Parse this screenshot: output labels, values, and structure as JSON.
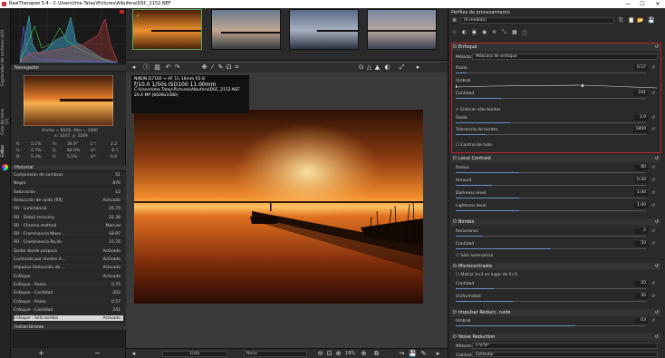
{
  "titlebar": {
    "title": "RawTherapee 5.4 - C:\\Users\\Ima Tatay\\Pictures\\Albufera\\DSC_2152.NEF",
    "minimize": "—",
    "maximize": "☐",
    "close": "✕"
  },
  "left_tabs": {
    "filebrowser": "Explorador de archivos (43)",
    "queue": "Cola de lotes [2]",
    "editor": "Editor"
  },
  "navigator": {
    "header": "Navegador",
    "size": "Ancho = 6028, Alto = 3380",
    "coords": "x: 3347, y: 3149"
  },
  "readout": {
    "r": "R:",
    "r_v": "5.1%",
    "g": "G:",
    "g_v": "4.7%",
    "b": "B:",
    "b_v": "5.3%",
    "h": "H:",
    "h_v": "34.9°",
    "s": "S:",
    "s_v": "84.0%",
    "vv": "V:",
    "vv_v": "5.1%",
    "L": "L*:",
    "L_v": "2.2",
    "a": "a*:",
    "a_v": "-0.7",
    "bb": "b*:",
    "bb_v": "4.0"
  },
  "history": {
    "header": "Historial",
    "rows": [
      [
        "Compresión de sombras",
        "51"
      ],
      [
        "Negro",
        "876"
      ],
      [
        "Saturación",
        "12"
      ],
      [
        "Reducción de ruido (RR)",
        "Activado"
      ],
      [
        "RR - Luminancia",
        "26.70"
      ],
      [
        "RR - Detail recovery",
        "22.38"
      ],
      [
        "RR - Chroma method",
        "Manual"
      ],
      [
        "RR - Crominancia Maes...",
        "18.97"
      ],
      [
        "RR - Crominancia Ro,Ve",
        "15.76"
      ],
      [
        "Quitar borde púrpura",
        "Activado"
      ],
      [
        "Contraste por niveles d...",
        "Activado"
      ],
      [
        "Impulsar Reducción de ...",
        "Activado"
      ],
      [
        "Enfoque",
        "Activado"
      ],
      [
        "Enfoque - Radio",
        "0.75"
      ],
      [
        "Enfoque - Cantidad",
        "202"
      ],
      [
        "Enfoque - Radio",
        "0.57"
      ],
      [
        "Enfoque - Cantidad",
        "241"
      ],
      [
        "Enfoque - Sólo bordes",
        "Activado"
      ]
    ]
  },
  "snapshots": {
    "header": "Instantáneas",
    "add": "+",
    "remove": "−"
  },
  "exif": {
    "camera": "NIKON D7100 + AF 11-16mm f/2.8",
    "params": "f/10.0  1/50s  ISO100  11.00mm",
    "path": "C:\\Users\\Ima Tatay\\Pictures\\Albufera\\DSC_2152.NEF",
    "size": "20.4 MP (6028x3380)"
  },
  "bottombar": {
    "mode": "Lista",
    "zoom": "19%",
    "none": "None"
  },
  "profile": {
    "header": "Perfiles de procesamiento",
    "value": "(A medida)"
  },
  "enfoque": {
    "title": "Enfoque",
    "method_label": "Método:",
    "method": "Máscara de enfoque",
    "radio_label": "Radio",
    "radio": "0.57",
    "umbral_label": "Umbral",
    "cantidad_label": "Cantidad",
    "cantidad": "241",
    "edges_label": "Enfocar sólo bordes",
    "e_radio_label": "Radio",
    "e_radio": "1.9",
    "tol_label": "Tolerancia de bordes",
    "tol": "1800",
    "halo_label": "Control de halo"
  },
  "local_contrast": {
    "title": "Local Contrast",
    "radius_label": "Radius",
    "radius": "80",
    "amount_label": "Amount",
    "amount": "0.20",
    "dark_label": "Darkness level",
    "dark": "1.00",
    "light_label": "Lightness level",
    "light": "1.00"
  },
  "bordes": {
    "title": "Bordes",
    "it_label": "Iteraciones",
    "it": "2",
    "cant_label": "Cantidad",
    "cant": "50",
    "lum_label": "Sólo luminancia"
  },
  "microcontraste": {
    "title": "Microcontraste",
    "matrix_label": "Matriz 3×3 en lugar de 5×5",
    "cant_label": "Cantidad",
    "cant": "20",
    "unif_label": "Uniformidad",
    "unif": "30"
  },
  "impulse": {
    "title": "Impulsar Reducc. ruido",
    "umbral_label": "Umbral",
    "umbral": "63"
  },
  "noise": {
    "title": "Noise Reduction",
    "method_label": "Método:",
    "method": "L*a*b*",
    "quality_label": "Calidad:",
    "quality": "Estándar"
  }
}
